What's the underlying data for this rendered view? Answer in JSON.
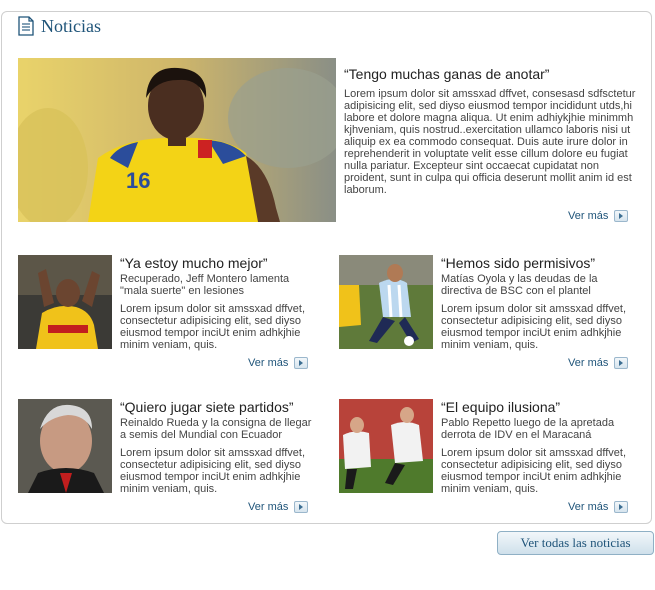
{
  "section": {
    "title": "Noticias",
    "icon": "document-icon"
  },
  "featured": {
    "headline": "“Tengo muchas ganas de anotar”",
    "body": "Lorem ipsum dolor sit amssxad dffvet, consesasd sdfsctetur adipisicing elit, sed diyso eiusmod tempor incididunt utds,hi labore et dolore magna aliqua. Ut enim adhiykjhie minimmh kjhveniam, quis nostrud..exercitation ullamco laboris nisi ut aliquip ex ea commodo consequat. Duis aute irure dolor in reprehenderit in voluptate velit esse cillum dolore eu fugiat nulla pariatur. Excepteur sint occaecat cupidatat non proident, sunt in culpa qui officia deserunt mollit anim id est laborum.",
    "more": "Ver más"
  },
  "news": [
    {
      "headline": "“Ya estoy mucho mejor”",
      "sub": "Recuperado, Jeff Montero lamenta \"mala suerte\" en lesiones",
      "body": "Lorem ipsum dolor sit amssxad dffvet, consectetur adipisicing elit, sed diyso eiusmod tempor inciUt enim adhkjhie minim veniam, quis.",
      "more": "Ver más"
    },
    {
      "headline": "“Hemos sido permisivos”",
      "sub": "Matías Oyola y las deudas de la directiva de BSC con el plantel",
      "body": "Lorem ipsum dolor sit amssxad dffvet, consectetur adipisicing elit, sed diyso eiusmod tempor inciUt enim adhkjhie minim veniam, quis.",
      "more": "Ver más"
    },
    {
      "headline": "“Quiero jugar siete partidos”",
      "sub": "Reinaldo Rueda y la consigna de llegar a semis del Mundial con Ecuador",
      "body": "Lorem ipsum dolor sit amssxad dffvet, consectetur adipisicing elit, sed diyso eiusmod tempor inciUt enim adhkjhie minim veniam, quis.",
      "more": "Ver más"
    },
    {
      "headline": "“El equipo ilusiona”",
      "sub": "Pablo Repetto luego de la apretada derrota de IDV en el Maracaná",
      "body": "Lorem ipsum dolor sit amssxad dffvet, consectetur adipisicing elit, sed diyso eiusmod tempor inciUt enim adhkjhie minim veniam, quis.",
      "more": "Ver más"
    }
  ],
  "all_button": "Ver todas las noticias",
  "colors": {
    "accent": "#1f5479",
    "border": "#cfcfcf"
  }
}
